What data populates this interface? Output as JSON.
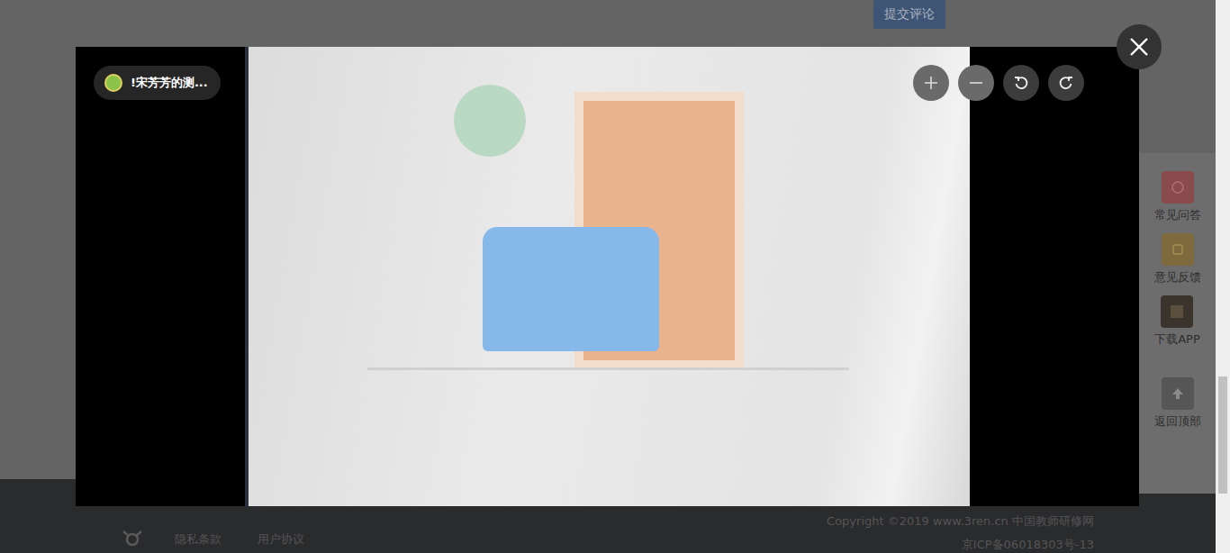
{
  "page": {
    "submit_button": "提交评论"
  },
  "side_tools": [
    {
      "label": "常见问答",
      "color": "#8a4b4f"
    },
    {
      "label": "意见反馈",
      "color": "#7e6a3c"
    },
    {
      "label": "下载APP",
      "color": "#3a342c"
    },
    {
      "label": "返回顶部",
      "color": "#565656"
    }
  ],
  "footer": {
    "links": [
      "隐私条款",
      "用户协议"
    ],
    "copyright": "Copyright ©2019 www.3ren.cn 中国教师研修网",
    "icp": "京ICP备06018303号-13"
  },
  "viewer": {
    "author": "!宋芳芳的测..."
  }
}
